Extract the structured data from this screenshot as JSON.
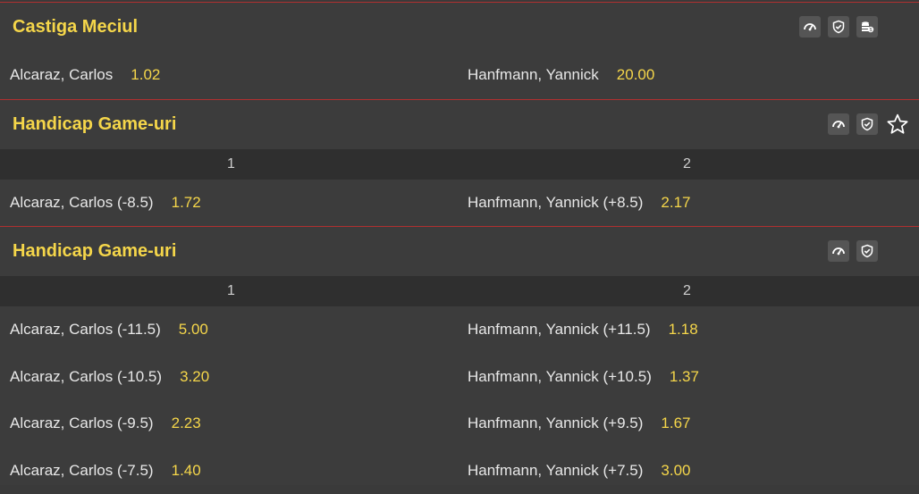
{
  "markets": [
    {
      "title": "Castiga Meciul",
      "icons": [
        "speedometer-icon",
        "shield-check-icon",
        "coins-icon"
      ],
      "columns": null,
      "rows": [
        [
          {
            "name": "Alcaraz, Carlos",
            "odd": "1.02"
          },
          {
            "name": "Hanfmann, Yannick",
            "odd": "20.00"
          }
        ]
      ]
    },
    {
      "title": "Handicap Game-uri",
      "icons": [
        "speedometer-icon",
        "shield-check-icon",
        "star-icon"
      ],
      "columns": [
        "1",
        "2"
      ],
      "rows": [
        [
          {
            "name": "Alcaraz, Carlos (-8.5)",
            "odd": "1.72"
          },
          {
            "name": "Hanfmann, Yannick (+8.5)",
            "odd": "2.17"
          }
        ]
      ]
    },
    {
      "title": "Handicap Game-uri",
      "icons": [
        "speedometer-icon",
        "shield-check-icon"
      ],
      "columns": [
        "1",
        "2"
      ],
      "rows": [
        [
          {
            "name": "Alcaraz, Carlos (-11.5)",
            "odd": "5.00"
          },
          {
            "name": "Hanfmann, Yannick (+11.5)",
            "odd": "1.18"
          }
        ],
        [
          {
            "name": "Alcaraz, Carlos (-10.5)",
            "odd": "3.20"
          },
          {
            "name": "Hanfmann, Yannick (+10.5)",
            "odd": "1.37"
          }
        ],
        [
          {
            "name": "Alcaraz, Carlos (-9.5)",
            "odd": "2.23"
          },
          {
            "name": "Hanfmann, Yannick (+9.5)",
            "odd": "1.67"
          }
        ],
        [
          {
            "name": "Alcaraz, Carlos (-7.5)",
            "odd": "1.40"
          },
          {
            "name": "Hanfmann, Yannick (+7.5)",
            "odd": "3.00"
          }
        ]
      ]
    }
  ],
  "colors": {
    "accent": "#f5d64a",
    "divider": "#b03030"
  }
}
